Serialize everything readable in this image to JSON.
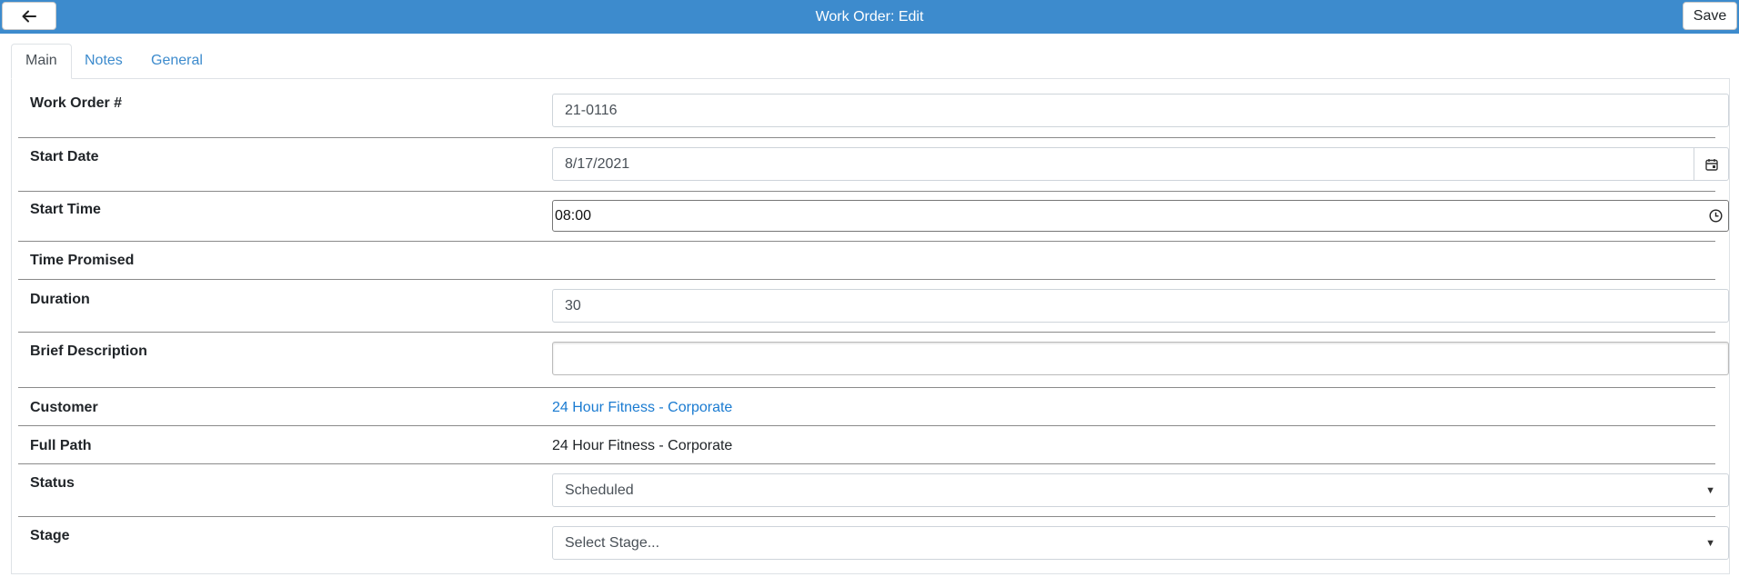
{
  "header": {
    "title": "Work Order: Edit",
    "save_label": "Save",
    "back_icon": "arrow-left-icon"
  },
  "tabs": [
    {
      "label": "Main",
      "active": true
    },
    {
      "label": "Notes",
      "active": false
    },
    {
      "label": "General",
      "active": false
    }
  ],
  "form": {
    "work_order": {
      "label": "Work Order #",
      "value": "21-0116"
    },
    "start_date": {
      "label": "Start Date",
      "value": "8/17/2021",
      "icon": "calendar-icon"
    },
    "start_time": {
      "label": "Start Time",
      "value": "08:00",
      "icon": "clock-icon"
    },
    "time_promised": {
      "label": "Time Promised"
    },
    "duration": {
      "label": "Duration",
      "value": "30"
    },
    "brief_description": {
      "label": "Brief Description",
      "value": ""
    },
    "customer": {
      "label": "Customer",
      "value": "24 Hour Fitness - Corporate"
    },
    "full_path": {
      "label": "Full Path",
      "value": "24 Hour Fitness - Corporate"
    },
    "status": {
      "label": "Status",
      "value": "Scheduled"
    },
    "stage": {
      "label": "Stage",
      "value": "Select Stage..."
    }
  },
  "colors": {
    "header_bg": "#3d8bcd",
    "link": "#1a7bd1"
  }
}
